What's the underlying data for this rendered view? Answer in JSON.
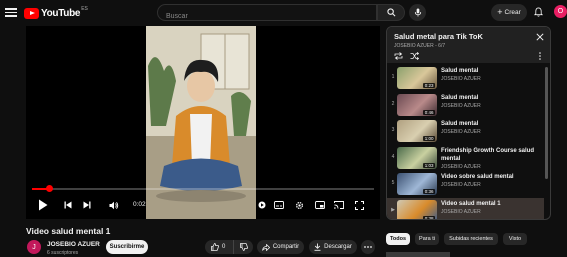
{
  "header": {
    "logo_text": "YouTube",
    "logo_country": "ES",
    "search_placeholder": "Buscar",
    "create_label": "Crear",
    "avatar_letter": "O"
  },
  "player": {
    "time_current": "0:02",
    "progress_fraction": 0.05
  },
  "video": {
    "title": "Video salud mental 1",
    "channel_name": "JOSEBIO AZUER",
    "channel_initial": "J",
    "subscribers": "6 suscriptores",
    "subscribe_label": "Suscribirme",
    "likes": "0",
    "share_label": "Compartir",
    "download_label": "Descargar"
  },
  "playlist": {
    "title": "Salud metal para Tik ToK",
    "subtitle": "JOSEBIO AZUER - 6/7",
    "items": [
      {
        "index": "1",
        "title": "Salud mental",
        "author": "JOSEBIO AZUER",
        "duration": "0:23",
        "active": false
      },
      {
        "index": "2",
        "title": "Salud mental",
        "author": "JOSEBIO AZUER",
        "duration": "0:46",
        "active": false
      },
      {
        "index": "3",
        "title": "Salud mental",
        "author": "JOSEBIO AZUER",
        "duration": "1:00",
        "active": false
      },
      {
        "index": "4",
        "title": "Friendship Growth Course salud mental",
        "author": "JOSEBIO AZUER",
        "duration": "1:03",
        "active": false
      },
      {
        "index": "5",
        "title": "Video sobre salud mental",
        "author": "JOSEBIO AZUER",
        "duration": "0:36",
        "active": false
      },
      {
        "index": "▶",
        "title": "Video salud mental 1",
        "author": "JOSEBIO AZUER",
        "duration": "0:38",
        "active": true
      }
    ]
  },
  "chips": [
    "Todos",
    "Para ti",
    "Subidas recientes",
    "Visto"
  ],
  "colors": {
    "background": "#0f0f0f",
    "brand_red": "#ff0000",
    "surface": "#272727"
  }
}
